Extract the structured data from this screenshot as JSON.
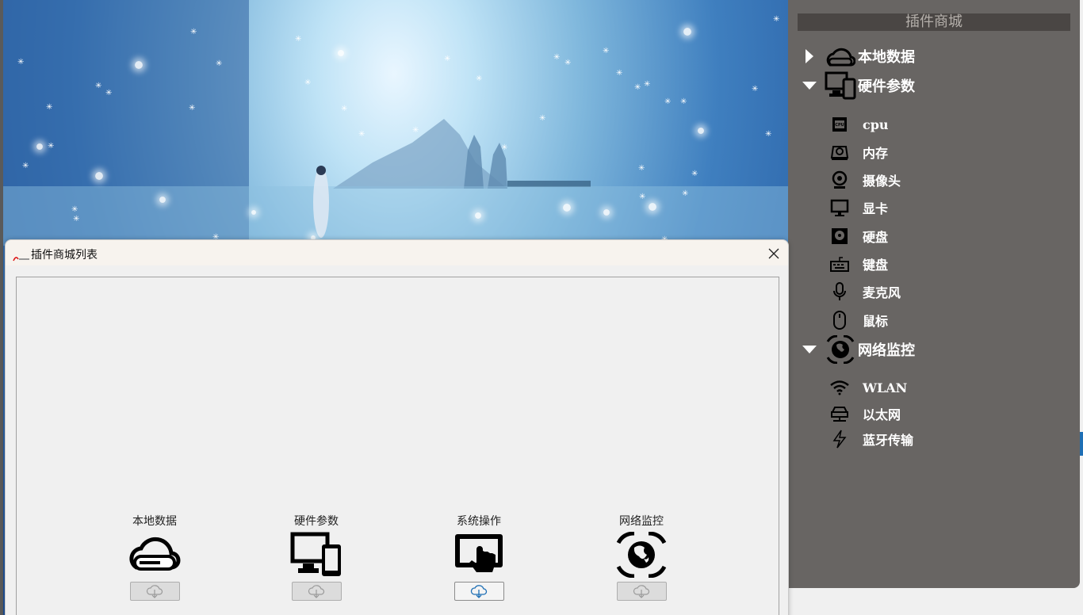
{
  "panel": {
    "title": "插件商城",
    "categories": [
      {
        "label": "本地数据",
        "icon": "cloud-drive-icon",
        "expanded": false
      },
      {
        "label": "硬件参数",
        "icon": "devices-icon",
        "expanded": true
      },
      {
        "label": "网络监控",
        "icon": "globe-icon",
        "expanded": true
      }
    ],
    "hardware_items": [
      {
        "label": "cpu",
        "icon": "cpu-icon"
      },
      {
        "label": "内存",
        "icon": "memory-icon"
      },
      {
        "label": "摄像头",
        "icon": "webcam-icon"
      },
      {
        "label": "显卡",
        "icon": "monitor-icon"
      },
      {
        "label": "硬盘",
        "icon": "harddisk-icon"
      },
      {
        "label": "键盘",
        "icon": "keyboard-icon"
      },
      {
        "label": "麦克风",
        "icon": "microphone-icon"
      },
      {
        "label": "鼠标",
        "icon": "mouse-icon"
      }
    ],
    "network_items": [
      {
        "label": "WLAN",
        "icon": "wifi-icon"
      },
      {
        "label": "以太网",
        "icon": "ethernet-icon"
      },
      {
        "label": "蓝牙传输",
        "icon": "lightning-icon"
      }
    ]
  },
  "dialog": {
    "title": "插件商城列表",
    "plugins": [
      {
        "name": "本地数据",
        "icon": "cloud-drive-icon",
        "download_enabled": false
      },
      {
        "name": "硬件参数",
        "icon": "devices-icon",
        "download_enabled": false
      },
      {
        "name": "系统操作",
        "icon": "touch-tablet-icon",
        "download_enabled": true
      },
      {
        "name": "网络监控",
        "icon": "globe-icon",
        "download_enabled": false
      }
    ]
  },
  "colors": {
    "panel_bg": "#686563",
    "panel_title_bg": "#4a4644",
    "accent_blue": "#1e6fb5",
    "dialog_bg": "#f0f0f0"
  }
}
